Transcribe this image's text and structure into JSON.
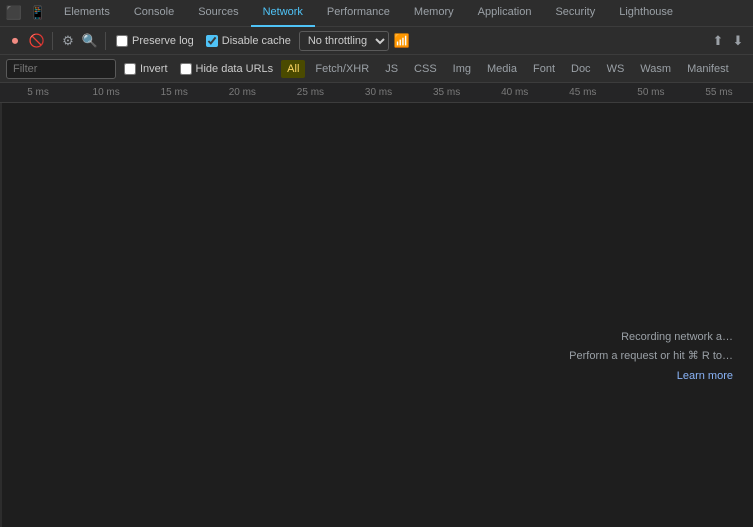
{
  "tabs": {
    "items": [
      {
        "label": "Elements",
        "name": "elements"
      },
      {
        "label": "Console",
        "name": "console"
      },
      {
        "label": "Sources",
        "name": "sources"
      },
      {
        "label": "Network",
        "name": "network"
      },
      {
        "label": "Performance",
        "name": "performance"
      },
      {
        "label": "Memory",
        "name": "memory"
      },
      {
        "label": "Application",
        "name": "application"
      },
      {
        "label": "Security",
        "name": "security"
      },
      {
        "label": "Lighthouse",
        "name": "lighthouse"
      }
    ],
    "active": "network"
  },
  "toolbar": {
    "preserve_log_label": "Preserve log",
    "disable_cache_label": "Disable cache",
    "throttle_value": "No throttling"
  },
  "filter_bar": {
    "filter_placeholder": "Filter",
    "invert_label": "Invert",
    "hide_data_urls_label": "Hide data URLs",
    "type_buttons": [
      {
        "label": "All",
        "active": true,
        "highlight": false
      },
      {
        "label": "Fetch/XHR",
        "active": false,
        "highlight": false
      },
      {
        "label": "JS",
        "active": false,
        "highlight": false
      },
      {
        "label": "CSS",
        "active": false,
        "highlight": false
      },
      {
        "label": "Img",
        "active": false,
        "highlight": false
      },
      {
        "label": "Media",
        "active": false,
        "highlight": false
      },
      {
        "label": "Font",
        "active": false,
        "highlight": false
      },
      {
        "label": "Doc",
        "active": false,
        "highlight": false
      },
      {
        "label": "WS",
        "active": false,
        "highlight": false
      },
      {
        "label": "Wasm",
        "active": false,
        "highlight": false
      },
      {
        "label": "Manifest",
        "active": false,
        "highlight": false
      }
    ]
  },
  "timeline": {
    "ticks": [
      "5 ms",
      "10 ms",
      "15 ms",
      "20 ms",
      "25 ms",
      "30 ms",
      "35 ms",
      "40 ms",
      "45 ms",
      "50 ms",
      "55 ms"
    ]
  },
  "empty_state": {
    "line1": "Recording network a…",
    "line2": "Perform a request or hit ⌘ R to…",
    "learn_more": "Learn more"
  }
}
